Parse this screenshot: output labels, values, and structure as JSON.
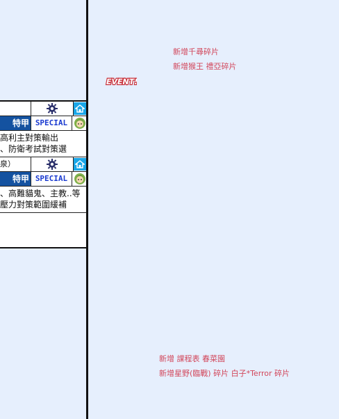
{
  "cards": [
    {
      "name": "",
      "grade": "特甲",
      "special": "SPECIAL",
      "desc": [
        "高利主對策輸出",
        "、防衛考試對策選"
      ]
    },
    {
      "name": "泉）",
      "grade": "特甲",
      "special": "SPECIAL",
      "desc": [
        "、高難貓鬼、主教..等",
        "壓力對策範圍緩補"
      ]
    }
  ],
  "news_top": {
    "line1": "新增千尋碎片",
    "line2": "新增猴王 禮亞碎片"
  },
  "event_badge": "EVENT!",
  "news_bottom": {
    "line1": "新增 課程表 春菜園",
    "line2": "新增星野(臨戰) 碎片  白子*Terror 碎片"
  },
  "colors": {
    "background": "#e6effd",
    "news_text": "#d2475b",
    "grade_bg": "#1452a0",
    "special_text": "#1a3ad0",
    "home_btn": "#1aa7e8"
  },
  "icons": [
    "gear-icon",
    "home-icon",
    "character-avatar-icon"
  ]
}
